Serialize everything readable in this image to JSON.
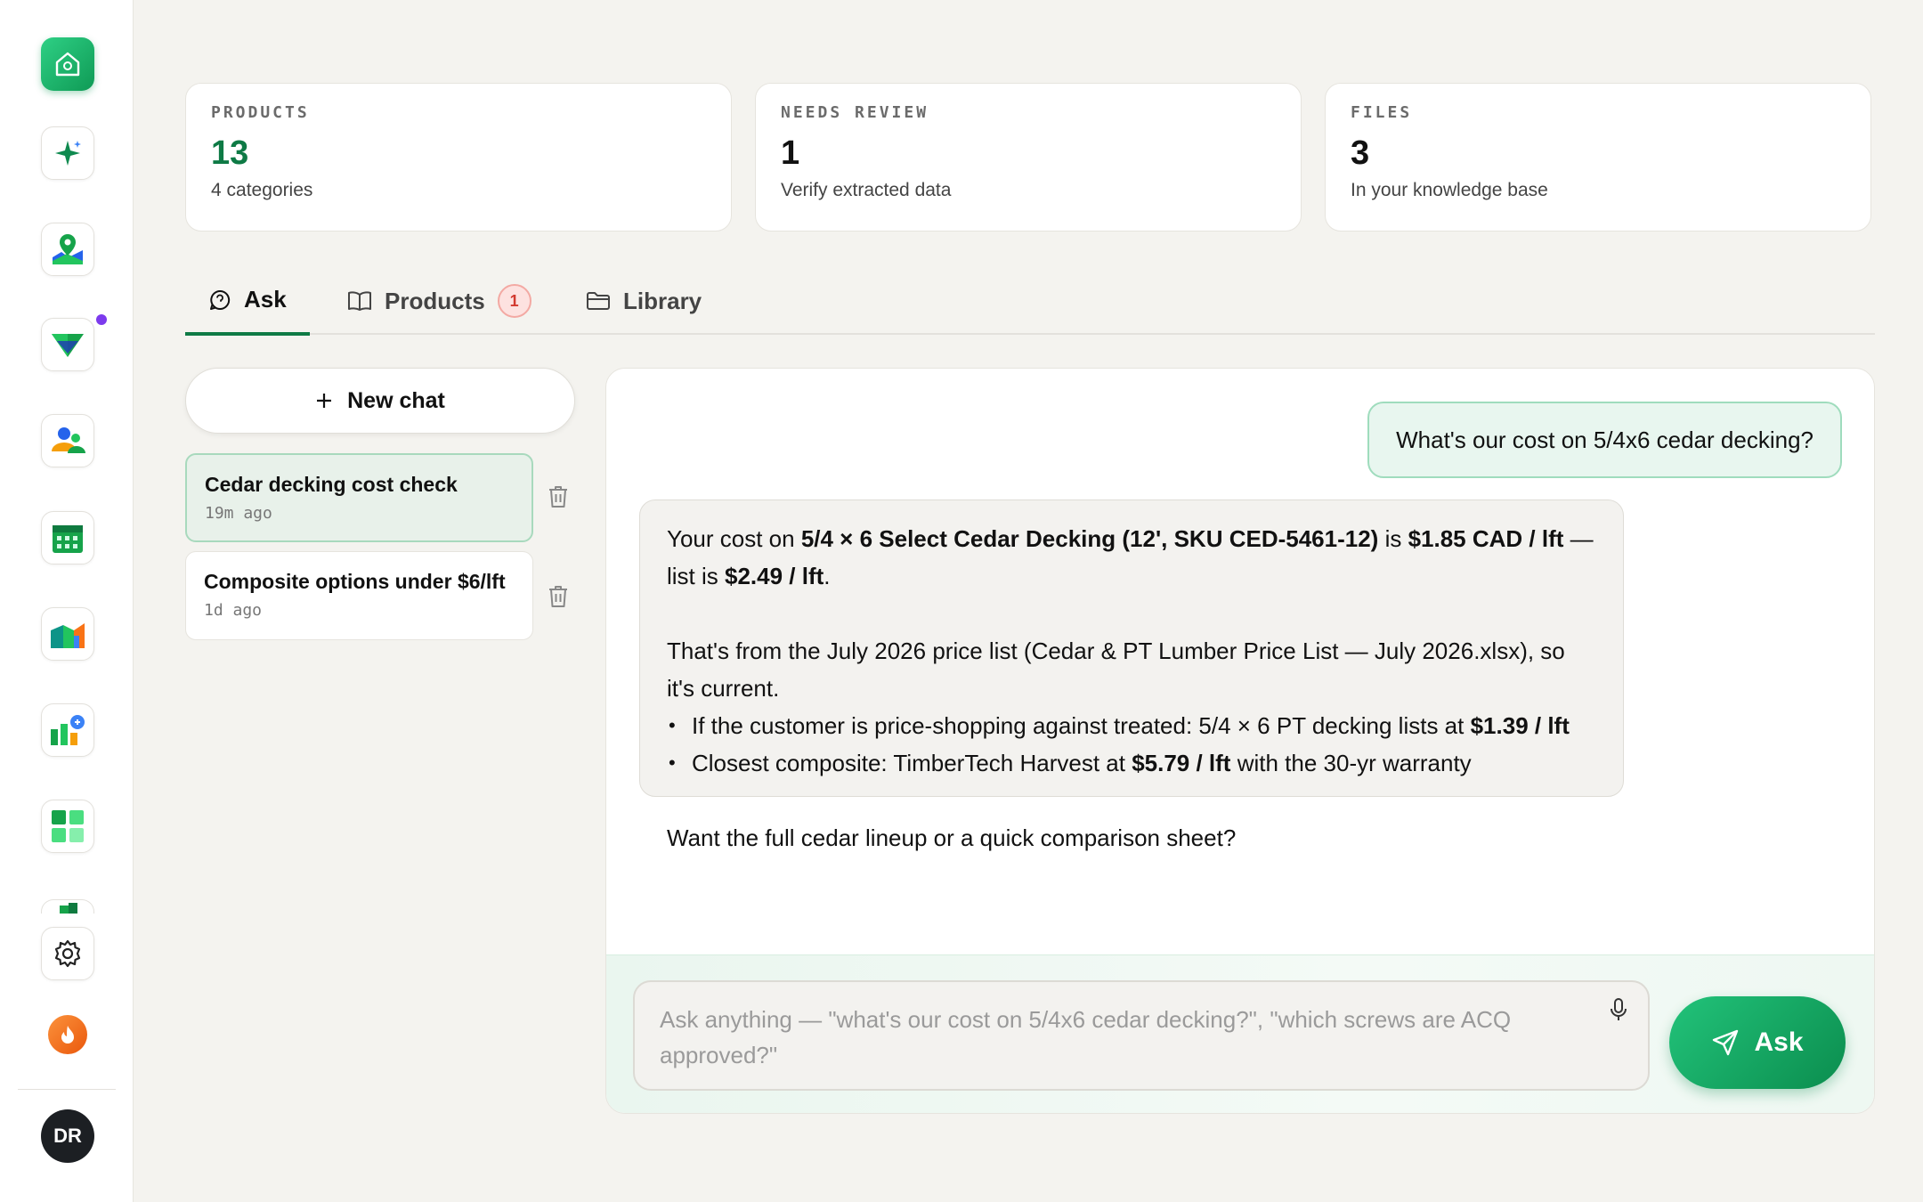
{
  "sidebar": {
    "icons": [
      "home-icon",
      "sparkle-icon",
      "map-icon",
      "shield-icon",
      "team-icon",
      "calendar-icon",
      "chart-icon",
      "insights-icon",
      "grid-icon",
      "settings-icon",
      "flame-icon"
    ],
    "avatar_initials": "DR"
  },
  "stats": [
    {
      "label": "PRODUCTS",
      "value": "13",
      "sub": "4 categories"
    },
    {
      "label": "NEEDS REVIEW",
      "value": "1",
      "sub": "Verify extracted data"
    },
    {
      "label": "FILES",
      "value": "3",
      "sub": "In your knowledge base"
    }
  ],
  "tabs": {
    "ask": "Ask",
    "products": "Products",
    "products_badge": "1",
    "library": "Library"
  },
  "chats": {
    "new_chat_label": "New chat",
    "items": [
      {
        "title": "Cedar decking cost check",
        "time": "19m ago"
      },
      {
        "title": "Composite options under $6/lft",
        "time": "1d ago"
      }
    ]
  },
  "conversation": {
    "user_message": "What's our cost on 5/4x6 cedar decking?",
    "bot": {
      "p1_a": "Your cost on ",
      "p1_b": "5/4 × 6 Select Cedar Decking (12', SKU CED-5461-12)",
      "p1_c": " is ",
      "p1_d": "$1.85 CAD / lft",
      "p1_e": " — list is ",
      "p1_f": "$2.49 / lft",
      "p1_g": ".",
      "p2": "That's from the July 2026 price list (Cedar & PT Lumber Price List — July 2026.xlsx), so it's current.",
      "b1_a": "If the customer is price-shopping against treated: 5/4 × 6 PT decking lists at ",
      "b1_b": "$1.39 / lft",
      "b2_a": "Closest composite: TimberTech Harvest at ",
      "b2_b": "$5.79 / lft",
      "b2_c": " with the 30-yr warranty",
      "p3": "Want the full cedar lineup or a quick comparison sheet?"
    }
  },
  "composer": {
    "placeholder": "Ask anything — \"what's our cost on 5/4x6 cedar decking?\", \"which screws are ACQ approved?\"",
    "ask_label": "Ask"
  },
  "colors": {
    "accent": "#0e7a45",
    "background": "#f4f3ef",
    "badge": "#d23a2f"
  }
}
